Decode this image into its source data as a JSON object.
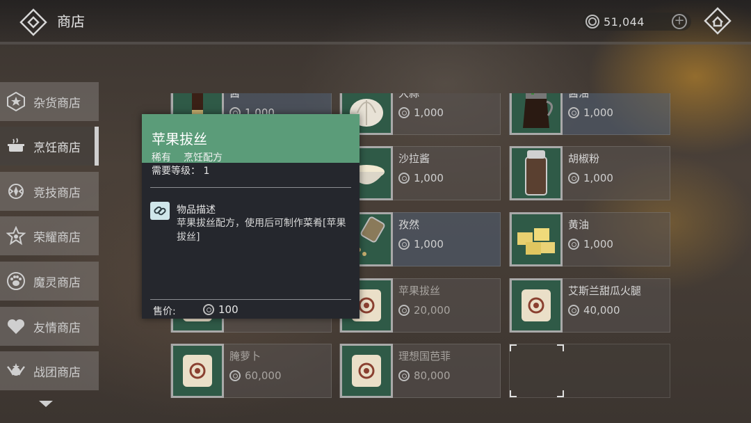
{
  "header": {
    "title": "商店",
    "currency_amount": "51,044",
    "back_icon": "diamond-back-icon",
    "home_icon": "home-icon"
  },
  "sidebar": {
    "items": [
      {
        "label": "杂货商店",
        "icon": "hexagon-star-icon",
        "active": false
      },
      {
        "label": "烹饪商店",
        "icon": "cooking-pot-icon",
        "active": true
      },
      {
        "label": "竞技商店",
        "icon": "arena-emblem-icon",
        "active": false
      },
      {
        "label": "荣耀商店",
        "icon": "star-emblem-icon",
        "active": false
      },
      {
        "label": "魔灵商店",
        "icon": "paw-icon",
        "active": false
      },
      {
        "label": "友情商店",
        "icon": "heart-icon",
        "active": false
      },
      {
        "label": "战团商店",
        "icon": "winged-badge-icon",
        "active": false
      }
    ]
  },
  "grid": {
    "items": [
      {
        "name": "酱",
        "price": "1,000",
        "icon": "soy-sauce-bottle-icon"
      },
      {
        "name": "大蒜",
        "price": "1,000",
        "icon": "garlic-icon"
      },
      {
        "name": "酱油",
        "price": "1,000",
        "icon": "sauce-pitcher-icon"
      },
      {
        "name": "",
        "price": "",
        "icon": "item-icon"
      },
      {
        "name": "沙拉酱",
        "price": "1,000",
        "icon": "mayo-bowl-icon"
      },
      {
        "name": "胡椒粉",
        "price": "1,000",
        "icon": "pepper-jar-icon"
      },
      {
        "name": "",
        "price": "",
        "icon": "item-icon"
      },
      {
        "name": "孜然",
        "price": "1,000",
        "icon": "cumin-jar-icon"
      },
      {
        "name": "黄油",
        "price": "1,000",
        "icon": "butter-icon"
      },
      {
        "name": "",
        "price": "",
        "icon": "recipe-scroll-icon"
      },
      {
        "name": "苹果拔丝",
        "price": "20,000",
        "icon": "recipe-scroll-icon"
      },
      {
        "name": "艾斯兰甜瓜火腿",
        "price": "40,000",
        "icon": "recipe-scroll-icon"
      },
      {
        "name": "腌萝卜",
        "price": "60,000",
        "icon": "recipe-scroll-icon"
      },
      {
        "name": "理想国芭菲",
        "price": "80,000",
        "icon": "recipe-scroll-icon"
      }
    ]
  },
  "tooltip": {
    "title": "苹果拔丝",
    "rarity": "稀有",
    "category": "烹饪配方",
    "level_req": "需要等级：  1",
    "desc_title": "物品描述",
    "desc": "苹果拔丝配方，使用后可制作菜肴[苹果拔丝]",
    "sell_label": "售价:",
    "sell_price": "100",
    "desc_icon": "link-icon"
  },
  "colors": {
    "tooltip_header": "#5b9c79",
    "tooltip_bg": "#25272d",
    "item_thumb_bg": "#2f5a47"
  }
}
